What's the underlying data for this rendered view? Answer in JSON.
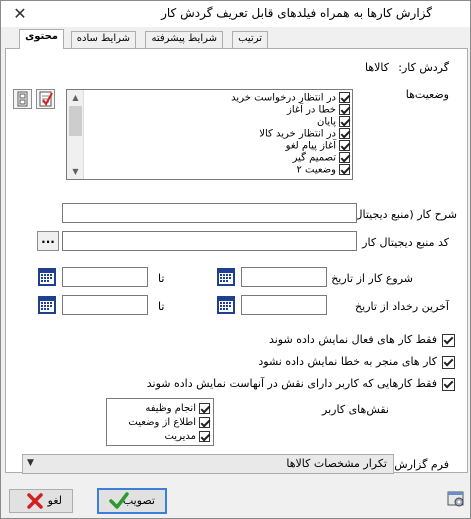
{
  "window": {
    "title": "گزارش کارها به همراه فیلدهای قابل تعریف گردش کار"
  },
  "tabs": [
    {
      "label": "محتوی",
      "active": true
    },
    {
      "label": "شرایط ساده",
      "active": false
    },
    {
      "label": "شرایط پیشرفته",
      "active": false
    },
    {
      "label": "ترتیب",
      "active": false
    }
  ],
  "workflow": {
    "label": "گردش کار:",
    "value": "کالاها"
  },
  "statuses": {
    "label": "وضعیت‌ها",
    "items": [
      {
        "label": "در انتظار درخواست خرید",
        "checked": true
      },
      {
        "label": "خطا در آغاز",
        "checked": true
      },
      {
        "label": "پایان",
        "checked": true
      },
      {
        "label": "در انتظار خرید کالا",
        "checked": true
      },
      {
        "label": "آغاز پیام لغو",
        "checked": true
      },
      {
        "label": "تصمیم گیر",
        "checked": true
      },
      {
        "label": "وضعیت ۲",
        "checked": true
      }
    ]
  },
  "fields": {
    "description_label": "شرح کار (منبع دیجیتال)",
    "description_value": "",
    "code_label": "کد منبع دیجیتال کار",
    "code_value": "",
    "dots_label": "...",
    "start_label": "شروع کار از تاریخ",
    "last_label": "آخرین رخداد از تاریخ",
    "to_label": "تا"
  },
  "options": [
    {
      "label": "فقط کار های فعال نمایش داده شوند",
      "checked": true
    },
    {
      "label": "کار های منجر به خطا نمایش داده نشود",
      "checked": true
    },
    {
      "label": "فقط کارهایی که کاربر دارای نقش در آنهاست نمایش داده شوند",
      "checked": true
    }
  ],
  "roles": {
    "label": "نقش‌های کاربر",
    "items": [
      {
        "label": "انجام وظیفه",
        "checked": true
      },
      {
        "label": "اطلاع از وضعیت",
        "checked": true
      },
      {
        "label": "مدیریت",
        "checked": true
      }
    ]
  },
  "report_form": {
    "label": "فرم گزارش",
    "value": "تکرار مشخصات کالاها"
  },
  "footer": {
    "ok_label": "تصویب",
    "cancel_label": "لغو"
  },
  "icons": {
    "close": "close-icon",
    "calendar": "calendar-icon",
    "check_all": "check-all-icon",
    "uncheck_all": "uncheck-all-icon",
    "ok": "green-check-icon",
    "cancel": "red-x-icon",
    "settings": "settings-icon"
  },
  "colors": {
    "accent": "#3c7fd6",
    "ok_green": "#2e9a2e",
    "cancel_red": "#d22020",
    "calendar_blue": "#1f3f8f"
  }
}
